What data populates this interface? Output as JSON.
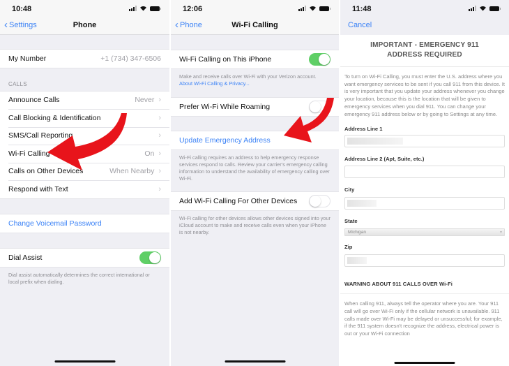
{
  "panel1": {
    "status_time": "10:48",
    "back_label": "Settings",
    "title": "Phone",
    "my_number": {
      "label": "My Number",
      "value": "+1 (734) 347-6506"
    },
    "calls_header": "CALLS",
    "calls_rows": [
      {
        "label": "Announce Calls",
        "value": "Never"
      },
      {
        "label": "Call Blocking & Identification",
        "value": ""
      },
      {
        "label": "SMS/Call Reporting",
        "value": ""
      },
      {
        "label": "Wi-Fi Calling",
        "value": "On"
      },
      {
        "label": "Calls on Other Devices",
        "value": "When Nearby"
      },
      {
        "label": "Respond with Text",
        "value": ""
      }
    ],
    "voicemail_link": "Change Voicemail Password",
    "dial_assist": {
      "label": "Dial Assist",
      "state": "on"
    },
    "dial_assist_note": "Dial assist automatically determines the correct international or local prefix when dialing."
  },
  "panel2": {
    "status_time": "12:06",
    "back_label": "Phone",
    "title": "Wi-Fi Calling",
    "wifi_calling_row": {
      "label": "Wi-Fi Calling on This iPhone",
      "state": "on"
    },
    "wifi_calling_note": "Make and receive calls over Wi-Fi with your Verizon account.",
    "wifi_calling_link": "About Wi-Fi Calling & Privacy...",
    "prefer_roaming_row": {
      "label": "Prefer Wi-Fi While Roaming",
      "state": "off"
    },
    "update_address_link": "Update Emergency Address",
    "update_address_note": "Wi-Fi calling requires an address to help emergency response services respond to calls. Review your carrier's emergency calling information to understand the availability of emergency calling over Wi-Fi.",
    "other_devices_row": {
      "label": "Add Wi-Fi Calling For Other Devices",
      "state": "off"
    },
    "other_devices_note": "Wi-Fi calling for other devices allows other devices signed into your iCloud account to make and receive calls even when your iPhone is not nearby."
  },
  "panel3": {
    "status_time": "11:48",
    "cancel_label": "Cancel",
    "title": "IMPORTANT - EMERGENCY 911 ADDRESS REQUIRED",
    "intro": "To turn on Wi-Fi Calling, you must enter the U.S. address where you want emergency services to be sent if you call 911 from this device. It is very important that you update your address whenever you change your location, because this is the location that will be given to emergency services when you dial 911. You can change your emergency 911 address below or by going to Settings at any time.",
    "fields": {
      "address1_label": "Address Line 1",
      "address2_label": "Address Line 2 (Apt, Suite, etc.)",
      "city_label": "City",
      "state_label": "State",
      "state_value": "Michigan",
      "zip_label": "Zip"
    },
    "warning_heading": "WARNING ABOUT 911 CALLS OVER Wi-Fi",
    "warning_body": "When calling 911, always tell the operator where you are. Your 911 call will go over Wi-Fi only if the cellular network is unavailable. 911 calls made over Wi-Fi may be delayed or unsuccessful; for example, if the 911 system doesn't recognize the address, electrical power is out or your Wi-Fi connection"
  },
  "colors": {
    "ios_blue": "#3b82f6",
    "toggle_green": "#5fcf66",
    "annotation_red": "#e8141b",
    "grouped_bg": "#efeff4"
  }
}
